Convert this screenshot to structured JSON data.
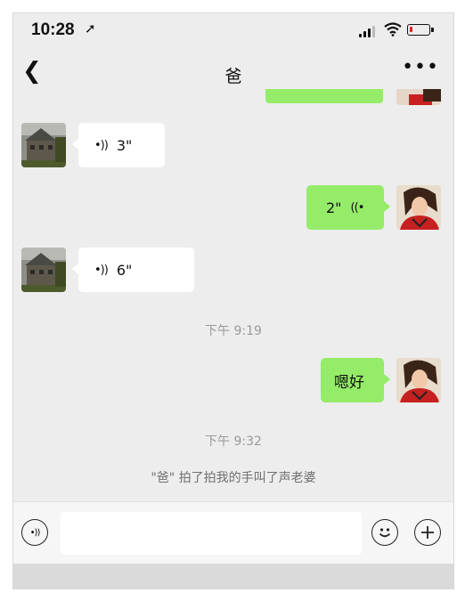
{
  "status_bar": {
    "time": "10:28",
    "location_icon": "location-arrow-icon",
    "signal_icon": "signal-bars-icon",
    "wifi_icon": "wifi-icon",
    "battery_icon": "battery-low-icon",
    "battery_level": 0.15,
    "battery_color": "#e02020"
  },
  "nav": {
    "back_icon": "chevron-left-icon",
    "title": "爸",
    "more_icon": "more-dots-icon"
  },
  "messages": [
    {
      "from": "contact",
      "type": "voice",
      "duration": "3\""
    },
    {
      "from": "me",
      "type": "voice",
      "duration": "2\""
    },
    {
      "from": "contact",
      "type": "voice",
      "duration": "6\""
    },
    {
      "timestamp": "下午 9:19"
    },
    {
      "from": "me",
      "type": "text",
      "text": "嗯好"
    },
    {
      "timestamp": "下午 9:32"
    },
    {
      "system": "\"爸\" 拍了拍我的手叫了声老婆"
    }
  ],
  "input_bar": {
    "voice_icon": "voice-mode-icon",
    "placeholder": "",
    "emoji_icon": "emoji-icon",
    "plus_icon": "plus-icon"
  },
  "colors": {
    "chat_background": "#ededed",
    "my_bubble": "#95ec69",
    "contact_bubble": "#ffffff",
    "timestamp_text": "#9a9a9a"
  }
}
